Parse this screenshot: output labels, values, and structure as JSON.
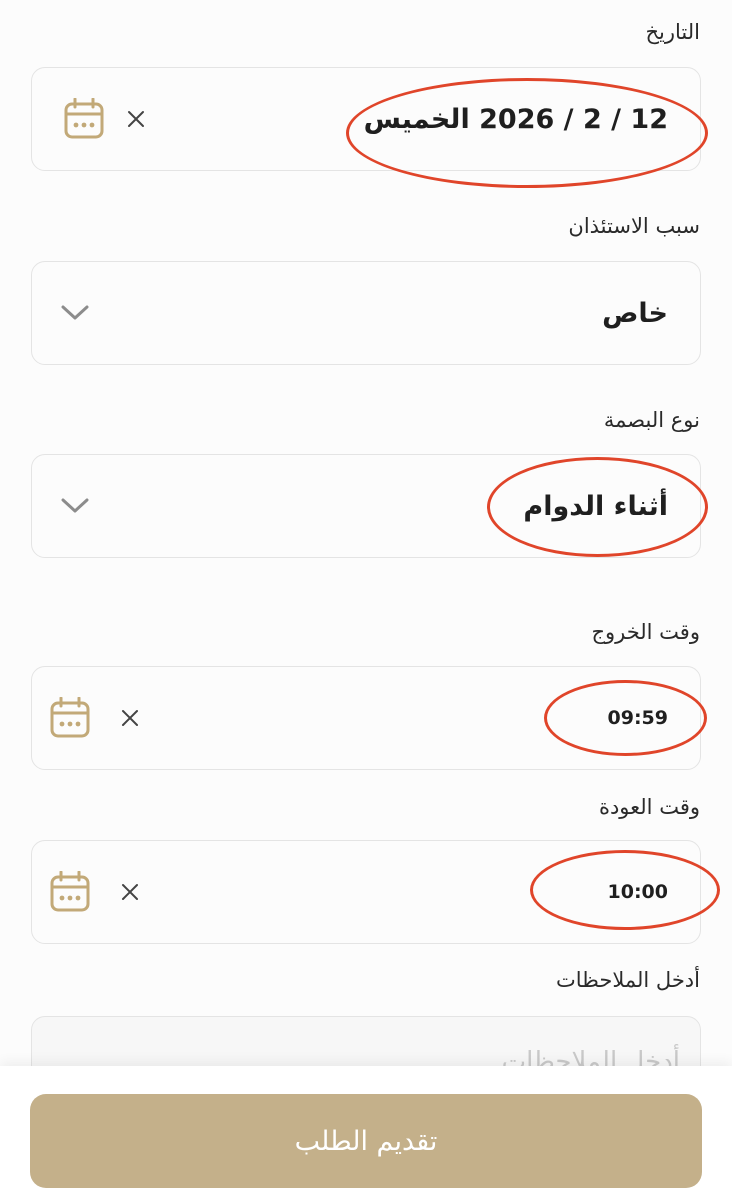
{
  "date": {
    "label": "التاريخ",
    "weekday": "الخميس",
    "value": "12 / 2 / 2026"
  },
  "reason": {
    "label": "سبب الاستئذان",
    "selected": "خاص"
  },
  "fingerprint_type": {
    "label": "نوع البصمة",
    "selected": "أثناء الدوام"
  },
  "exit_time": {
    "label": "وقت الخروج",
    "value": "09:59"
  },
  "return_time": {
    "label": "وقت العودة",
    "value": "10:00"
  },
  "notes": {
    "label": "أدخل الملاحظات",
    "placeholder": "أدخل الملاحظات"
  },
  "submit": {
    "label": "تقديم الطلب"
  },
  "colors": {
    "accent": "#c4b08a",
    "icon": "#c2a978",
    "annotation_ring": "#e0452a",
    "border": "#e4e4e4",
    "chevron": "#8c8c8c"
  },
  "icons": {
    "calendar": "calendar-icon",
    "clear": "close-icon",
    "dropdown": "chevron-down-icon"
  }
}
